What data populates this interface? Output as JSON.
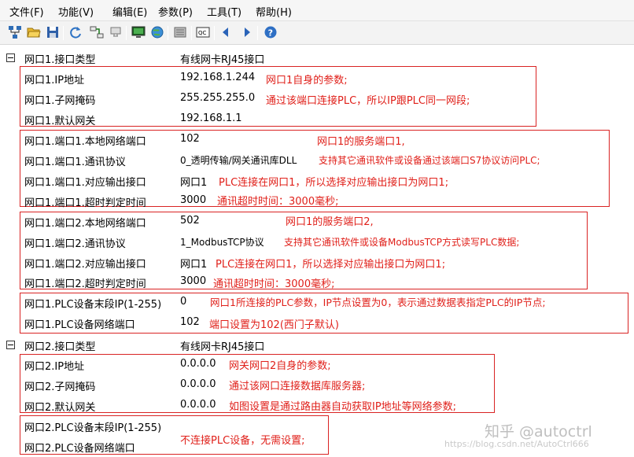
{
  "menu": [
    "文件(F)",
    "功能(V)",
    "编辑(E)",
    "参数(P)",
    "工具(T)",
    "帮助(H)"
  ],
  "toolbar_icons": [
    "network-icon",
    "open-folder-icon",
    "save-icon",
    "refresh-icon",
    "connect-icon",
    "plug-icon",
    "monitor-icon",
    "globe-icon",
    "device-icon",
    "config-icon",
    "arrow-left-icon",
    "arrow-right-icon",
    "help-icon"
  ],
  "net1": {
    "header_label": "网口1.接口类型",
    "header_value": "有线网卡RJ45接口",
    "ip_label": "网口1.IP地址",
    "ip_value": "192.168.1.244",
    "ip_note": "网口1自身的参数;",
    "mask_label": "网口1.子网掩码",
    "mask_value": "255.255.255.0",
    "mask_note": "通过该端口连接PLC，所以IP跟PLC同一网段;",
    "gw_label": "网口1.默认网关",
    "gw_value": "192.168.1.1",
    "p1_port_label": "网口1.端口1.本地网络端口",
    "p1_port_value": "102",
    "p1_port_note": "网口1的服务端口1,",
    "p1_proto_label": "网口1.端口1.通讯协议",
    "p1_proto_value": "0_透明传输/网关通讯库DLL",
    "p1_proto_note": "支持其它通讯软件或设备通过该端口S7协议访问PLC;",
    "p1_out_label": "网口1.端口1.对应输出接口",
    "p1_out_value": "网口1",
    "p1_out_note": "PLC连接在网口1，所以选择对应输出接口为网口1;",
    "p1_to_label": "网口1.端口1.超时判定时间",
    "p1_to_value": "3000",
    "p1_to_note": "通讯超时时间：3000毫秒;",
    "p2_port_label": "网口1.端口2.本地网络端口",
    "p2_port_value": "502",
    "p2_port_note": "网口1的服务端口2,",
    "p2_proto_label": "网口1.端口2.通讯协议",
    "p2_proto_value": "1_ModbusTCP协议",
    "p2_proto_note": "支持其它通讯软件或设备ModbusTCP方式读写PLC数据;",
    "p2_out_label": "网口1.端口2.对应输出接口",
    "p2_out_value": "网口1",
    "p2_out_note": "PLC连接在网口1，所以选择对应输出接口为网口1;",
    "p2_to_label": "网口1.端口2.超时判定时间",
    "p2_to_value": "3000",
    "p2_to_note": "通讯超时时间：3000毫秒;",
    "plc_ip_label": "网口1.PLC设备末段IP(1-255)",
    "plc_ip_value": "0",
    "plc_ip_note": "网口1所连接的PLC参数，IP节点设置为0，表示通过数据表指定PLC的IP节点;",
    "plc_port_label": "网口1.PLC设备网络端口",
    "plc_port_value": "102",
    "plc_port_note": "端口设置为102(西门子默认)"
  },
  "net2": {
    "header_label": "网口2.接口类型",
    "header_value": "有线网卡RJ45接口",
    "ip_label": "网口2.IP地址",
    "ip_value": "0.0.0.0",
    "ip_note": "网关网口2自身的参数;",
    "mask_label": "网口2.子网掩码",
    "mask_value": "0.0.0.0",
    "mask_note": "通过该网口连接数据库服务器;",
    "gw_label": "网口2.默认网关",
    "gw_value": "0.0.0.0",
    "gw_note": "如图设置是通过路由器自动获取IP地址等网络参数;",
    "plc_ip_label": "网口2.PLC设备末段IP(1-255)",
    "plc_port_label": "网口2.PLC设备网络端口",
    "plc_note": "不连接PLC设备，无需设置;"
  },
  "watermark": "知乎 @autoctrl",
  "watermark_url": "https://blog.csdn.net/AutoCtrl666"
}
